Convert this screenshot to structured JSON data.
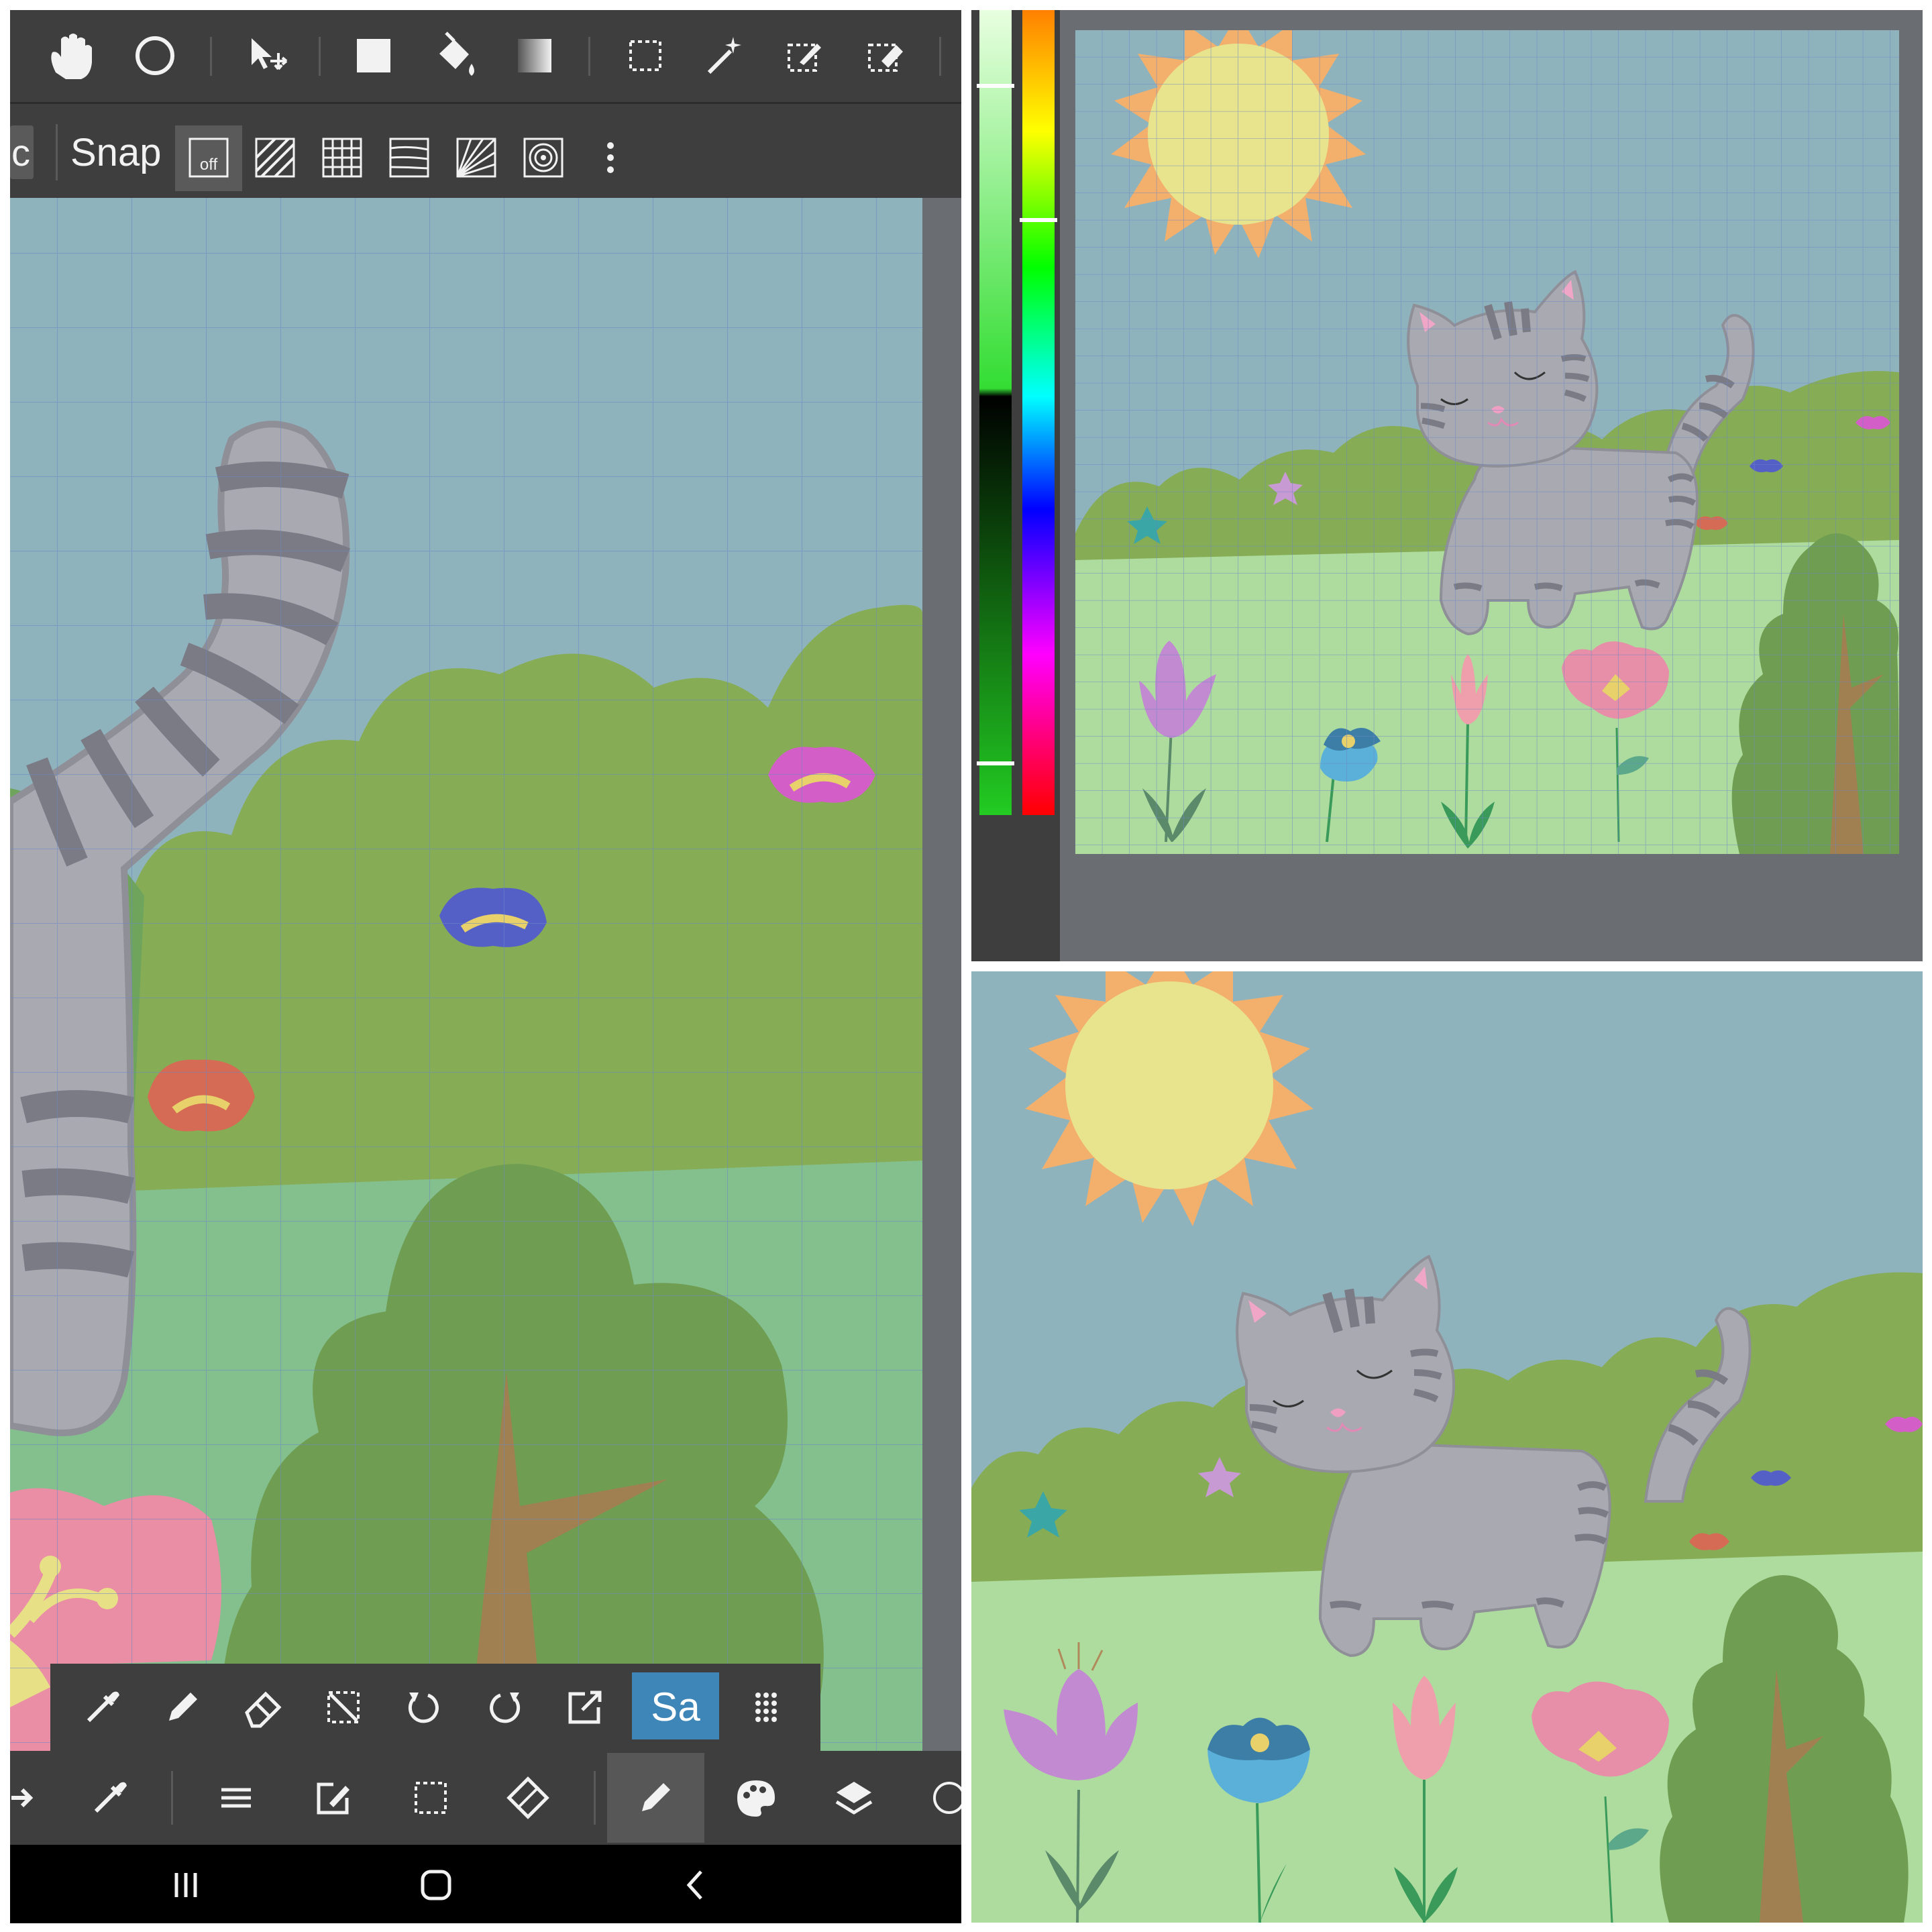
{
  "app": {
    "snap_toolbar": {
      "label": "Snap",
      "off_label": "off"
    },
    "brush_toolbar": {
      "sa_label": "Sa"
    },
    "top_tools": [
      "hand",
      "lasso",
      "move",
      "fill-rect",
      "bucket",
      "gradient",
      "rect-select",
      "magic-wand",
      "select-pen",
      "select-eraser"
    ],
    "snap_modes": [
      "off",
      "parallel",
      "grid",
      "horizontal",
      "radial",
      "circle",
      "more"
    ],
    "bottom_tools": [
      "eyedropper",
      "pen",
      "eraser",
      "deselect",
      "undo",
      "redo",
      "export",
      "sa",
      "dots"
    ],
    "main_tools": [
      "redo",
      "eyedropper",
      "menu",
      "edit",
      "select",
      "transform",
      "pen",
      "palette",
      "layers",
      "more"
    ],
    "nav": [
      "recent-apps",
      "home",
      "back"
    ],
    "colors": {
      "sky": "#8fb3bd",
      "grass": "#aedc9e",
      "bush": "#86ad55",
      "tree": "#6f9e52",
      "trunk": "#a08050",
      "cat": "#a9a9b1",
      "cat_stripe": "#7b7b85",
      "sun": "#e8e48e",
      "sun_rays": "#f3b06c",
      "toolbar": "#3e3e3e",
      "accent": "#3f86b8"
    }
  }
}
